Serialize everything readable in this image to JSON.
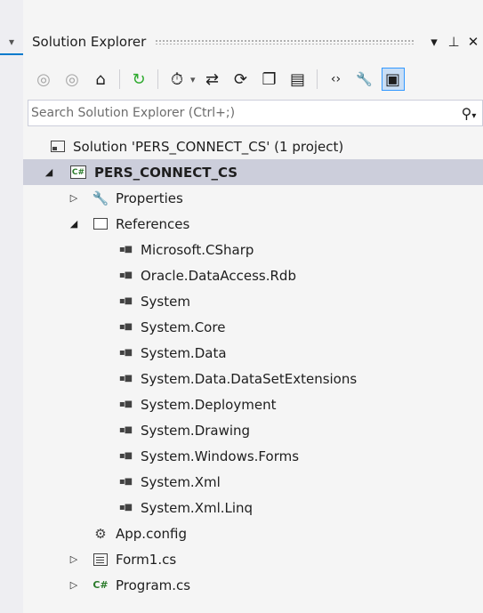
{
  "left_tab": {
    "marker": "▾"
  },
  "title": {
    "text": "Solution Explorer",
    "dropdown_glyph": "▾",
    "pin_glyph": "⊥",
    "close_glyph": "✕"
  },
  "toolbar": {
    "back_glyph": "◎",
    "forward_glyph": "◎",
    "home_glyph": "⌂",
    "pending_changes_glyph": "↻",
    "history_glyph": "⏱",
    "sync_glyph": "⇄",
    "refresh_glyph": "⟳",
    "collapse_glyph": "❐",
    "show_all_glyph": "▤",
    "view_code_glyph": "‹›",
    "properties_glyph": "🔧",
    "preview_glyph": "▣",
    "dropdown_glyph": "▾"
  },
  "search": {
    "placeholder": "Search Solution Explorer (Ctrl+;)",
    "icon_glyph": "⚲",
    "options_glyph": "▾"
  },
  "tree": {
    "solution": "Solution 'PERS_CONNECT_CS' (1 project)",
    "project": "PERS_CONNECT_CS",
    "project_icon_text": "C#",
    "properties": "Properties",
    "references": "References",
    "reference_items": [
      "Microsoft.CSharp",
      "Oracle.DataAccess.Rdb",
      "System",
      "System.Core",
      "System.Data",
      "System.Data.DataSetExtensions",
      "System.Deployment",
      "System.Drawing",
      "System.Windows.Forms",
      "System.Xml",
      "System.Xml.Linq"
    ],
    "reference_icon_glyph": "▪■",
    "app_config": "App.config",
    "form1": "Form1.cs",
    "program": "Program.cs",
    "cs_icon_text": "C#",
    "expanded_glyph": "◢",
    "collapsed_glyph": "▷"
  },
  "colors": {
    "selected_row": "#cccedb",
    "accent": "#007acc",
    "panel_bg": "#f5f5f5"
  }
}
